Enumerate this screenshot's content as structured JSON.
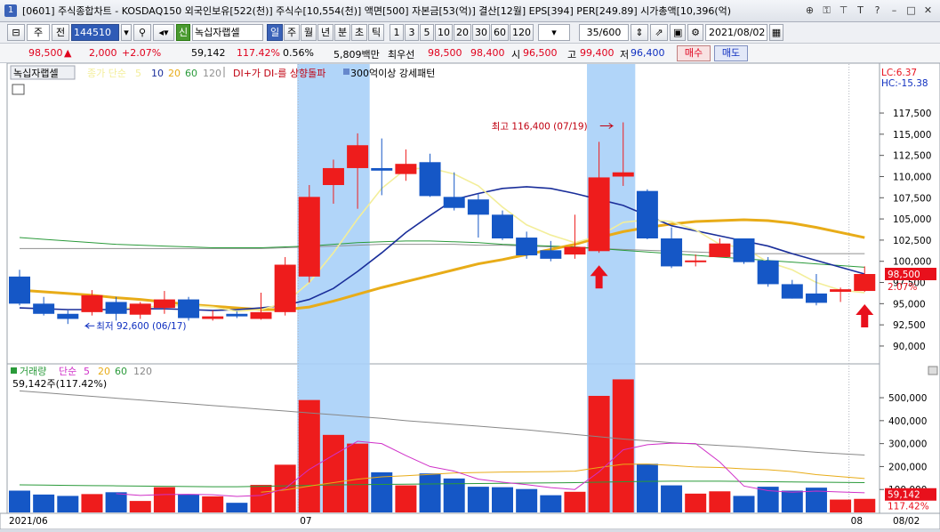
{
  "window": {
    "number": "1",
    "title": "[0601] 주식종합차트 - KOSDAQ150 외국인보유[522(천)] 주식수[10,554(천)] 액면[500] 자본금[53(억)] 결산[12월] EPS[394] PER[249.89] 시가총액[10,396(억)"
  },
  "toolbar": {
    "type_select": "주",
    "prev_label": "전",
    "code": "144510",
    "name_tag": "신",
    "stock_name": "녹십자랩셀",
    "periods": [
      "일",
      "주",
      "월",
      "년",
      "분",
      "초",
      "틱"
    ],
    "active_period": "일",
    "minutes": [
      "1",
      "3",
      "5",
      "10",
      "20",
      "30",
      "60",
      "120"
    ],
    "range": "35/600",
    "date": "2021/08/02"
  },
  "quote": {
    "price": "98,500",
    "arrow": "▲",
    "change": "2,000",
    "change_pct": "+2.07%",
    "volume": "59,142",
    "vol_ratio": "117.42%",
    "turnover": "0.56%",
    "amount": "5,809백만",
    "priority_label": "최우선",
    "ask": "98,500",
    "bid": "98,400",
    "open_label": "시",
    "open": "96,500",
    "high_label": "고",
    "high": "99,400",
    "low_label": "저",
    "low": "96,400",
    "buy_label": "매수",
    "sell_label": "매도"
  },
  "price_panel": {
    "legend_name": "녹십자랩셀",
    "legend_ma_label": "종가 단순",
    "legend_ma": [
      "5",
      "10",
      "20",
      "60",
      "120"
    ],
    "legend_signal": "DI+가 DI-를 상향돌파",
    "legend_pattern": "300억이상 강세패턴",
    "lc_label": "LC:6.37",
    "hc_label": "HC:-15.38",
    "max_annotation": "최고 116,400 (07/19)",
    "min_annotation": "최저 92,600 (06/17)",
    "last_price_tag": "98,500",
    "last_pct_tag": "2.07%",
    "y_ticks": [
      "117,500",
      "115,000",
      "112,500",
      "110,000",
      "107,500",
      "105,000",
      "102,500",
      "100,000",
      "97,500",
      "95,000",
      "92,500",
      "90,000"
    ]
  },
  "volume_panel": {
    "legend_name": "거래량",
    "legend_ma_label": "단순",
    "legend_ma": [
      "5",
      "20",
      "60",
      "120"
    ],
    "current": "59,142주(117.42%)",
    "last_tag": "59,142",
    "last_pct_tag": "117.42%",
    "y_ticks": [
      "500,000",
      "400,000",
      "300,000",
      "200,000",
      "100,000"
    ]
  },
  "x_axis": {
    "labels": [
      "2021/06",
      "07",
      "08"
    ],
    "right_label": "08/02"
  },
  "colors": {
    "up": "#ee1c1c",
    "down": "#1557c6",
    "highlight": "#a8d0f8",
    "ma5": "#f3ee9a",
    "ma10": "#1a2e9a",
    "ma20": "#e8ac18",
    "ma60": "#2a9a3a",
    "ma120": "#909090"
  },
  "chart_data": {
    "type": "candlestick",
    "candles": [
      {
        "o": 98200,
        "h": 99000,
        "l": 94800,
        "c": 95000
      },
      {
        "o": 95000,
        "h": 95800,
        "l": 93600,
        "c": 93800
      },
      {
        "o": 93800,
        "h": 94200,
        "l": 92600,
        "c": 93200
      },
      {
        "o": 94000,
        "h": 96600,
        "l": 93600,
        "c": 96000
      },
      {
        "o": 95200,
        "h": 95800,
        "l": 93000,
        "c": 93800
      },
      {
        "o": 93700,
        "h": 95200,
        "l": 93200,
        "c": 95000
      },
      {
        "o": 94500,
        "h": 96500,
        "l": 93800,
        "c": 95500
      },
      {
        "o": 95500,
        "h": 95800,
        "l": 93000,
        "c": 93300
      },
      {
        "o": 93200,
        "h": 94200,
        "l": 93000,
        "c": 93500
      },
      {
        "o": 93800,
        "h": 94100,
        "l": 93300,
        "c": 93500
      },
      {
        "o": 93200,
        "h": 96300,
        "l": 93100,
        "c": 94000
      },
      {
        "o": 94000,
        "h": 100500,
        "l": 93600,
        "c": 99600
      },
      {
        "o": 98200,
        "h": 109000,
        "l": 97500,
        "c": 107600
      },
      {
        "o": 109000,
        "h": 112000,
        "l": 106800,
        "c": 111000
      },
      {
        "o": 111000,
        "h": 115100,
        "l": 106200,
        "c": 113700
      },
      {
        "o": 111000,
        "h": 114500,
        "l": 107800,
        "c": 110700
      },
      {
        "o": 110300,
        "h": 113200,
        "l": 109500,
        "c": 111500
      },
      {
        "o": 111700,
        "h": 112700,
        "l": 107600,
        "c": 107700
      },
      {
        "o": 107600,
        "h": 110500,
        "l": 106000,
        "c": 106300
      },
      {
        "o": 107300,
        "h": 108000,
        "l": 102800,
        "c": 105500
      },
      {
        "o": 105500,
        "h": 106000,
        "l": 102500,
        "c": 102700
      },
      {
        "o": 102800,
        "h": 103500,
        "l": 100300,
        "c": 100700
      },
      {
        "o": 101300,
        "h": 102400,
        "l": 100000,
        "c": 100300
      },
      {
        "o": 100800,
        "h": 105500,
        "l": 100300,
        "c": 101700
      },
      {
        "o": 101200,
        "h": 114100,
        "l": 101000,
        "c": 109900
      },
      {
        "o": 110000,
        "h": 116400,
        "l": 108900,
        "c": 110500
      },
      {
        "o": 108300,
        "h": 108500,
        "l": 102600,
        "c": 102700
      },
      {
        "o": 102700,
        "h": 104000,
        "l": 99200,
        "c": 99400
      },
      {
        "o": 100100,
        "h": 100800,
        "l": 99400,
        "c": 100100
      },
      {
        "o": 100500,
        "h": 102700,
        "l": 100500,
        "c": 102100
      },
      {
        "o": 102700,
        "h": 102700,
        "l": 99700,
        "c": 99900
      },
      {
        "o": 100100,
        "h": 100500,
        "l": 97000,
        "c": 97300
      },
      {
        "o": 97300,
        "h": 97800,
        "l": 95600,
        "c": 95600
      },
      {
        "o": 96200,
        "h": 98500,
        "l": 94800,
        "c": 95100
      },
      {
        "o": 96400,
        "h": 96900,
        "l": 95200,
        "c": 96700
      },
      {
        "o": 96500,
        "h": 99400,
        "l": 96400,
        "c": 98500
      }
    ],
    "volumes": [
      95000,
      78000,
      72000,
      80000,
      88000,
      50000,
      110000,
      78000,
      70000,
      42000,
      120000,
      208000,
      490000,
      338000,
      300000,
      175000,
      118000,
      170000,
      148000,
      112000,
      110000,
      102000,
      75000,
      90000,
      508000,
      580000,
      212000,
      118000,
      82000,
      92000,
      72000,
      112000,
      95000,
      108000,
      56000,
      59142
    ],
    "ma5": [
      null,
      null,
      null,
      null,
      94400,
      94600,
      94700,
      94800,
      94600,
      94100,
      94300,
      95100,
      97500,
      101000,
      105000,
      108600,
      110900,
      111000,
      110300,
      108900,
      106400,
      104300,
      103100,
      102200,
      103000,
      104600,
      104900,
      104700,
      103700,
      102000,
      101600,
      99900,
      99000,
      97500,
      96600,
      96300
    ],
    "ma10": [
      94500,
      94400,
      94300,
      94300,
      94300,
      94400,
      94400,
      94300,
      94200,
      94300,
      94500,
      94800,
      95500,
      96800,
      98800,
      101000,
      103400,
      105400,
      107300,
      108000,
      108600,
      108800,
      108600,
      108000,
      107300,
      106600,
      105400,
      104200,
      103600,
      103000,
      102400,
      101800,
      100900,
      100100,
      99300,
      98500
    ],
    "ma20": [
      96600,
      96400,
      96200,
      96000,
      95700,
      95500,
      95200,
      94900,
      94700,
      94500,
      94300,
      94300,
      94600,
      95300,
      96100,
      96900,
      97600,
      98300,
      99000,
      99700,
      100200,
      100800,
      101400,
      102000,
      102800,
      103500,
      104000,
      104400,
      104700,
      104800,
      104900,
      104800,
      104500,
      104000,
      103400,
      102800
    ],
    "ma60": [
      102800,
      102600,
      102400,
      102200,
      102000,
      101900,
      101800,
      101700,
      101600,
      101600,
      101600,
      101700,
      101800,
      102000,
      102200,
      102300,
      102400,
      102400,
      102300,
      102200,
      102000,
      101900,
      101800,
      101700,
      101500,
      101300,
      101100,
      100900,
      100700,
      100500,
      100300,
      100100,
      99900,
      99700,
      99500,
      99300
    ],
    "ma120": [
      101500,
      101500,
      101500,
      101500,
      101500,
      101500,
      101500,
      101500,
      101500,
      101500,
      101500,
      101600,
      101700,
      101800,
      101900,
      102000,
      102000,
      102000,
      102000,
      101900,
      101900,
      101800,
      101700,
      101600,
      101500,
      101400,
      101300,
      101200,
      101100,
      101000,
      100900,
      100900,
      100900,
      100900,
      100900,
      100900
    ],
    "vol_ma5": [
      null,
      null,
      null,
      null,
      82000,
      74000,
      78000,
      79000,
      77000,
      70000,
      74000,
      104000,
      188000,
      250000,
      310000,
      300000,
      248000,
      200000,
      180000,
      145000,
      132000,
      121000,
      108000,
      100000,
      177000,
      273000,
      295000,
      302000,
      300000,
      220000,
      115000,
      95000,
      88000,
      93000,
      89000,
      86000
    ],
    "vol_ma20": [
      null,
      null,
      null,
      null,
      null,
      null,
      null,
      null,
      null,
      null,
      88000,
      98000,
      115000,
      130000,
      145000,
      155000,
      160000,
      166000,
      172000,
      174000,
      176000,
      177000,
      178000,
      180000,
      196000,
      210000,
      211000,
      205000,
      198000,
      196000,
      190000,
      186000,
      178000,
      165000,
      156000,
      148000
    ],
    "vol_ma60": [
      120000,
      119000,
      118000,
      117000,
      116000,
      115000,
      114000,
      113000,
      112000,
      112000,
      114000,
      116000,
      118000,
      120000,
      121000,
      122000,
      123000,
      124000,
      125000,
      126000,
      127000,
      128000,
      129000,
      130000,
      132000,
      134000,
      135000,
      136000,
      136000,
      136000,
      135000,
      134000,
      133000,
      132000,
      131000,
      130000
    ],
    "vol_ma120": [
      530000,
      522000,
      514000,
      506000,
      498000,
      490000,
      482000,
      474000,
      466000,
      458000,
      450000,
      442000,
      434000,
      426000,
      418000,
      410000,
      400000,
      392000,
      384000,
      376000,
      368000,
      360000,
      350000,
      340000,
      330000,
      320000,
      312000,
      304000,
      298000,
      292000,
      286000,
      278000,
      270000,
      262000,
      256000,
      250000
    ],
    "highlight_ranges": [
      [
        12,
        14
      ],
      [
        24,
        25
      ]
    ],
    "signal_arrows": [
      24,
      35
    ],
    "price_range": [
      88000,
      119500
    ],
    "volume_range": [
      0,
      570000
    ]
  }
}
